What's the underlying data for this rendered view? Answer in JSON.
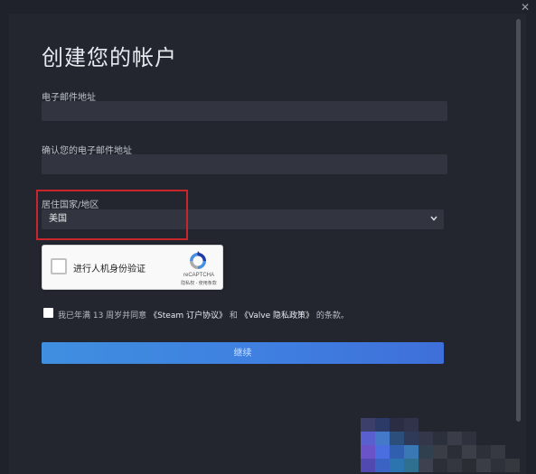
{
  "window": {
    "close_glyph": "✕"
  },
  "form": {
    "title": "创建您的帐户",
    "email_label": "电子邮件地址",
    "email_value": "",
    "confirm_email_label": "确认您的电子邮件地址",
    "confirm_email_value": "",
    "country_label": "居住国家/地区",
    "country_value": "美国",
    "highlight_color": "#c9262b"
  },
  "recaptcha": {
    "checkbox_label": "进行人机身份验证",
    "brand": "reCAPTCHA",
    "terms": "隐私权 - 使用条款",
    "logo_icon": "recaptcha-logo"
  },
  "agreement": {
    "prefix": "我已年满 13 周岁并同意",
    "steam_link": "《Steam 订户协议》",
    "and": "和",
    "valve_link": "《Valve 隐私政策》",
    "suffix": "的条款。"
  },
  "continue_button": {
    "label": "继续",
    "color": "#3f86e0"
  }
}
